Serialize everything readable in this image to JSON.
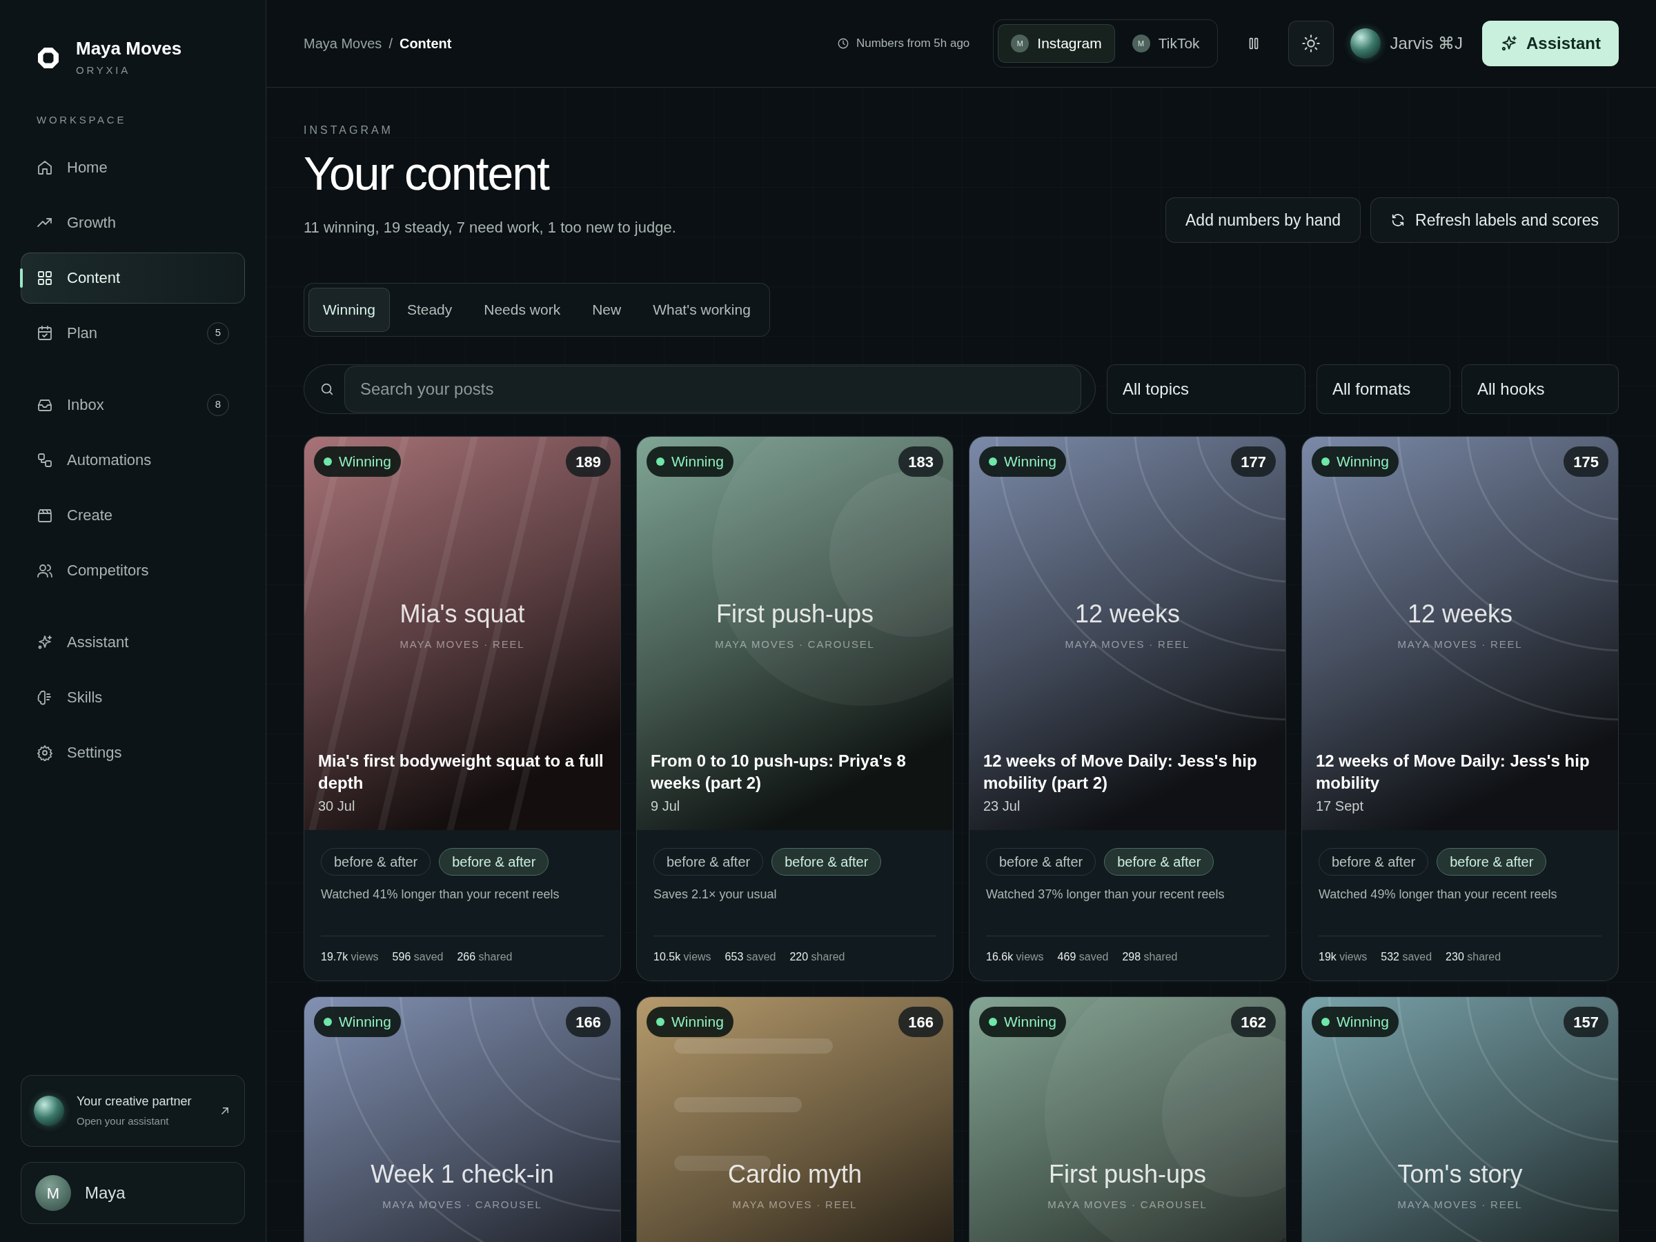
{
  "brand": {
    "name": "Maya Moves",
    "company": "ORYXIA"
  },
  "sidebar": {
    "section_label": "WORKSPACE",
    "groups": [
      [
        {
          "label": "Home",
          "selected": false
        },
        {
          "label": "Growth",
          "selected": false
        },
        {
          "label": "Content",
          "selected": true
        },
        {
          "label": "Plan",
          "selected": false,
          "badge": "5"
        }
      ],
      [
        {
          "label": "Inbox",
          "selected": false,
          "badge": "8"
        },
        {
          "label": "Automations",
          "selected": false
        },
        {
          "label": "Create",
          "selected": false
        },
        {
          "label": "Competitors",
          "selected": false
        }
      ],
      [
        {
          "label": "Assistant",
          "selected": false
        },
        {
          "label": "Skills",
          "selected": false
        },
        {
          "label": "Settings",
          "selected": false
        }
      ]
    ],
    "partner": {
      "title": "Your creative partner",
      "subtitle": "Open your assistant"
    },
    "user": {
      "initial": "M",
      "name": "Maya"
    }
  },
  "header": {
    "breadcrumb": [
      "Maya Moves",
      "/",
      "Content"
    ],
    "freshness": "Numbers from 5h ago",
    "platforms": [
      {
        "label": "Instagram",
        "initial": "M",
        "selected": true
      },
      {
        "label": "TikTok",
        "initial": "M",
        "selected": false
      }
    ],
    "assistant_name": "Jarvis ⌘J",
    "assistant_button": "Assistant"
  },
  "page": {
    "eyebrow": "INSTAGRAM",
    "title": "Your content",
    "summary": "11 winning, 19 steady, 7 need work, 1 too new to judge.",
    "actions": [
      "Add numbers by hand",
      "Refresh labels and scores"
    ],
    "tabs": [
      {
        "label": "Winning",
        "selected": true
      },
      {
        "label": "Steady",
        "selected": false
      },
      {
        "label": "Needs work",
        "selected": false
      },
      {
        "label": "New",
        "selected": false
      },
      {
        "label": "What's working",
        "selected": false
      }
    ],
    "search": {
      "placeholder": "Search your posts"
    },
    "filters": [
      "All topics",
      "All formats",
      "All hooks"
    ]
  },
  "posts": [
    {
      "status": "Winning",
      "score": "189",
      "color": "#a87378",
      "kind": "lines",
      "cover_title": "Mia's squat",
      "cover_subtitle": "MAYA MOVES · REEL",
      "title": "Mia's first bodyweight squat to a full depth",
      "date": "30 Jul",
      "tags": [
        {
          "label": "before & after",
          "highlighted": false
        },
        {
          "label": "before & after",
          "highlighted": true
        }
      ],
      "insight": "Watched 41% longer than your recent reels",
      "stats": [
        "19.7k views",
        "596 saved",
        "266 shared"
      ]
    },
    {
      "status": "Winning",
      "score": "183",
      "color": "#7fa595",
      "kind": "circles",
      "cover_title": "First push-ups",
      "cover_subtitle": "MAYA MOVES · CAROUSEL",
      "title": "From 0 to 10 push-ups: Priya's 8 weeks (part 2)",
      "date": "9 Jul",
      "tags": [
        {
          "label": "before & after",
          "highlighted": false
        },
        {
          "label": "before & after",
          "highlighted": true
        }
      ],
      "insight": "Saves 2.1× your usual",
      "stats": [
        "10.5k views",
        "653 saved",
        "220 shared"
      ]
    },
    {
      "status": "Winning",
      "score": "177",
      "color": "#7b8aa8",
      "kind": "arcs",
      "cover_title": "12 weeks",
      "cover_subtitle": "MAYA MOVES · REEL",
      "title": "12 weeks of Move Daily: Jess's hip mobility (part 2)",
      "date": "23 Jul",
      "tags": [
        {
          "label": "before & after",
          "highlighted": false
        },
        {
          "label": "before & after",
          "highlighted": true
        }
      ],
      "insight": "Watched 37% longer than your recent reels",
      "stats": [
        "16.6k views",
        "469 saved",
        "298 shared"
      ]
    },
    {
      "status": "Winning",
      "score": "175",
      "color": "#7b8aa8",
      "kind": "arcs",
      "cover_title": "12 weeks",
      "cover_subtitle": "MAYA MOVES · REEL",
      "title": "12 weeks of Move Daily: Jess's hip mobility",
      "date": "17 Sept",
      "tags": [
        {
          "label": "before & after",
          "highlighted": false
        },
        {
          "label": "before & after",
          "highlighted": true
        }
      ],
      "insight": "Watched 49% longer than your recent reels",
      "stats": [
        "19k views",
        "532 saved",
        "230 shared"
      ]
    },
    {
      "status": "Winning",
      "score": "166",
      "color": "#8291b3",
      "kind": "arcs",
      "cover_title": "Week 1 check-in",
      "cover_subtitle": "MAYA MOVES · CAROUSEL"
    },
    {
      "status": "Winning",
      "score": "166",
      "color": "#b59a6c",
      "kind": "bars",
      "cover_title": "Cardio myth",
      "cover_subtitle": "MAYA MOVES · REEL"
    },
    {
      "status": "Winning",
      "score": "162",
      "color": "#84a594",
      "kind": "circles",
      "cover_title": "First push-ups",
      "cover_subtitle": "MAYA MOVES · CAROUSEL"
    },
    {
      "status": "Winning",
      "score": "157",
      "color": "#79a3aa",
      "kind": "arcs",
      "cover_title": "Tom's story",
      "cover_subtitle": "MAYA MOVES · REEL"
    }
  ]
}
